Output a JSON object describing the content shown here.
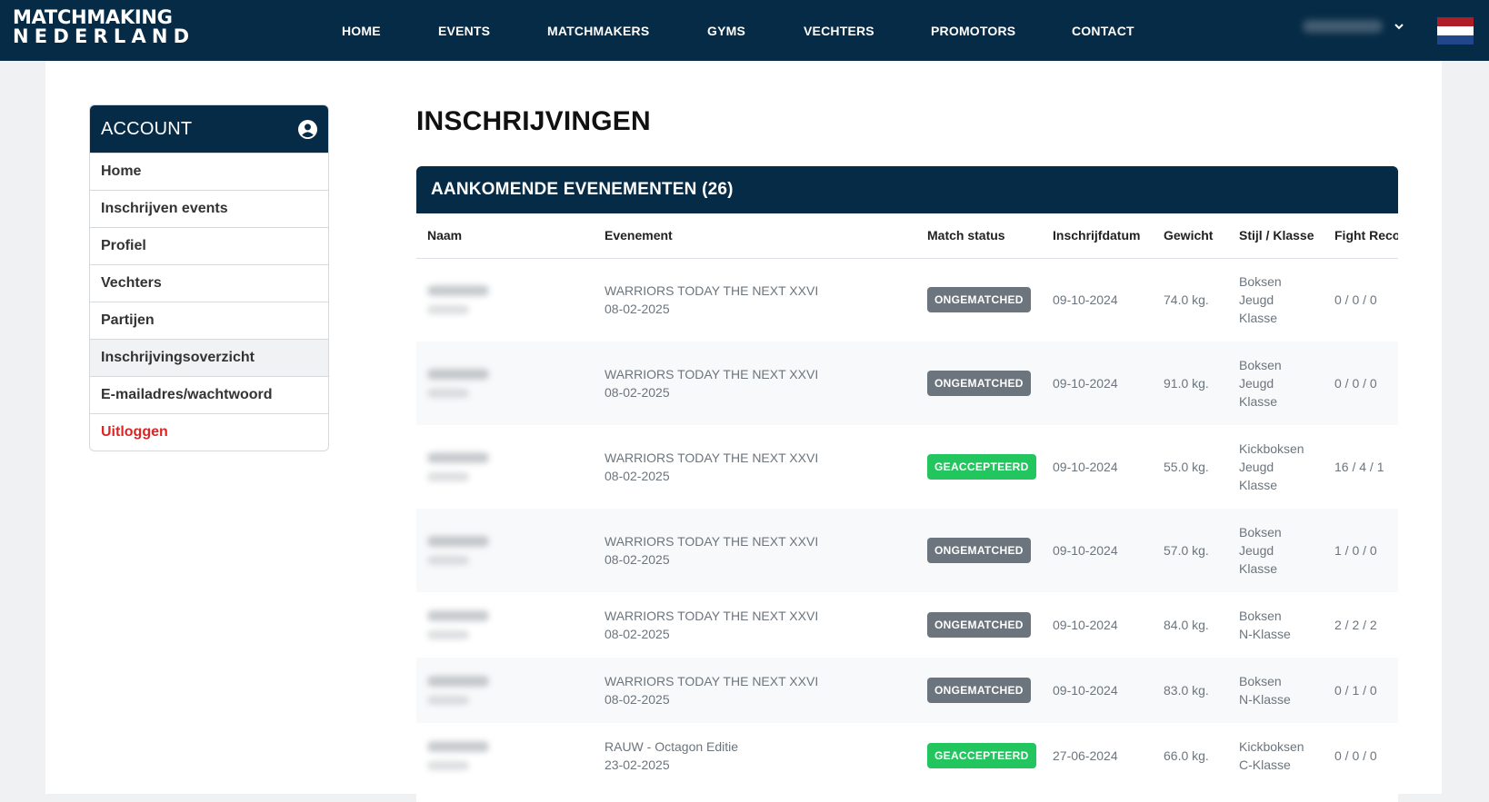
{
  "brand": {
    "line1": "MATCHMAKING",
    "line2": "NEDERLAND"
  },
  "nav": {
    "items": [
      "HOME",
      "EVENTS",
      "MATCHMAKERS",
      "GYMS",
      "VECHTERS",
      "PROMOTORS",
      "CONTACT"
    ]
  },
  "user_menu": {
    "icon": "chevron-down-icon"
  },
  "flag": {
    "colors": [
      "#ae1c28",
      "#ffffff",
      "#21468b"
    ]
  },
  "sidebar": {
    "title": "ACCOUNT",
    "icon": "user-circle-icon",
    "items": [
      {
        "label": "Home"
      },
      {
        "label": "Inschrijven events"
      },
      {
        "label": "Profiel"
      },
      {
        "label": "Vechters"
      },
      {
        "label": "Partijen"
      },
      {
        "label": "Inschrijvingsoverzicht"
      },
      {
        "label": "E-mailadres/wachtwoord"
      },
      {
        "label": "Uitloggen"
      }
    ]
  },
  "page_title": "INSCHRIJVINGEN",
  "card": {
    "title": "AANKOMENDE EVENEMENTEN (26)",
    "columns": [
      "Naam",
      "Evenement",
      "Match status",
      "Inschrijfdatum",
      "Gewicht",
      "Stijl / Klasse",
      "Fight Reco"
    ],
    "rows": [
      {
        "event": "WARRIORS TODAY THE NEXT XXVI",
        "event_date": "08-02-2025",
        "status": "ONGEMATCHED",
        "reg_date": "09-10-2024",
        "weight": "74.0 kg.",
        "style": [
          "Boksen",
          "Jeugd",
          "Klasse"
        ],
        "record": "0 / 0 / 0"
      },
      {
        "event": "WARRIORS TODAY THE NEXT XXVI",
        "event_date": "08-02-2025",
        "status": "ONGEMATCHED",
        "reg_date": "09-10-2024",
        "weight": "91.0 kg.",
        "style": [
          "Boksen",
          "Jeugd",
          "Klasse"
        ],
        "record": "0 / 0 / 0"
      },
      {
        "event": "WARRIORS TODAY THE NEXT XXVI",
        "event_date": "08-02-2025",
        "status": "GEACCEPTEERD",
        "reg_date": "09-10-2024",
        "weight": "55.0 kg.",
        "style": [
          "Kickboksen",
          "Jeugd",
          "Klasse"
        ],
        "record": "16 / 4 / 1"
      },
      {
        "event": "WARRIORS TODAY THE NEXT XXVI",
        "event_date": "08-02-2025",
        "status": "ONGEMATCHED",
        "reg_date": "09-10-2024",
        "weight": "57.0 kg.",
        "style": [
          "Boksen",
          "Jeugd",
          "Klasse"
        ],
        "record": "1 / 0 / 0"
      },
      {
        "event": "WARRIORS TODAY THE NEXT XXVI",
        "event_date": "08-02-2025",
        "status": "ONGEMATCHED",
        "reg_date": "09-10-2024",
        "weight": "84.0 kg.",
        "style": [
          "Boksen",
          "N-Klasse"
        ],
        "record": "2 / 2 / 2"
      },
      {
        "event": "WARRIORS TODAY THE NEXT XXVI",
        "event_date": "08-02-2025",
        "status": "ONGEMATCHED",
        "reg_date": "09-10-2024",
        "weight": "83.0 kg.",
        "style": [
          "Boksen",
          "N-Klasse"
        ],
        "record": "0 / 1 / 0"
      },
      {
        "event": "RAUW - Octagon Editie",
        "event_date": "23-02-2025",
        "status": "GEACCEPTEERD",
        "reg_date": "27-06-2024",
        "weight": "66.0 kg.",
        "style": [
          "Kickboksen",
          "C-Klasse"
        ],
        "record": "0 / 0 / 0"
      }
    ]
  },
  "status_colors": {
    "ONGEMATCHED": "#6c757d",
    "GEACCEPTEERD": "#22c55e"
  }
}
